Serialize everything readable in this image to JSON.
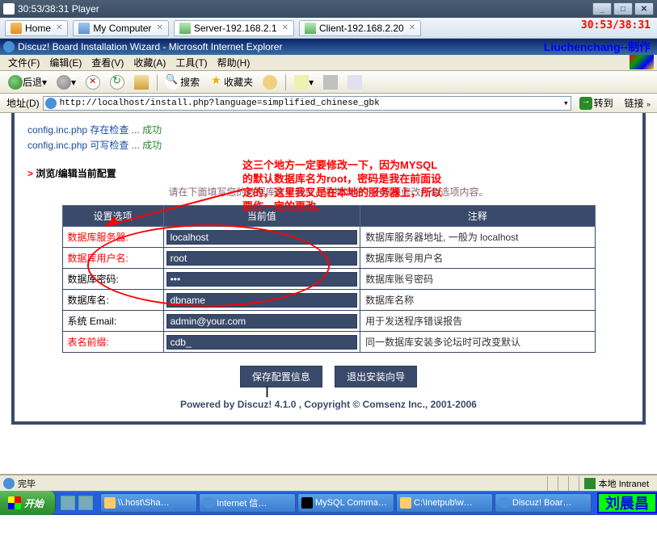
{
  "player": {
    "title": "30:53/38:31 Player",
    "timer": "30:53/38:31",
    "author": "Liuchenchang--制作"
  },
  "outer_tabs": [
    {
      "label": "Home"
    },
    {
      "label": "My Computer"
    },
    {
      "label": "Server-192.168.2.1"
    },
    {
      "label": "Client-192.168.2.20"
    }
  ],
  "ie": {
    "title": "Discuz! Board Installation Wizard - Microsoft Internet Explorer",
    "menus": [
      "文件(F)",
      "编辑(E)",
      "查看(V)",
      "收藏(A)",
      "工具(T)",
      "帮助(H)"
    ],
    "toolbar": {
      "back": "后退",
      "search": "搜索",
      "favorites": "收藏夹"
    },
    "address_label": "地址(D)",
    "url": "http://localhost/install.php?language=simplified_chinese_gbk",
    "go": "转到",
    "links": "链接",
    "status_done": "完毕",
    "status_zone": "本地 Intranet"
  },
  "page": {
    "checks": [
      {
        "text": "config.inc.php 存在检查 ... ",
        "status": "成功"
      },
      {
        "text": "config.inc.php 可写检查 ... ",
        "status": "成功"
      }
    ],
    "section_arrow": ">",
    "section_title": "浏览/编辑当前配置",
    "annotation_l1": "这三个地方一定要修改一下，因为MYSQL",
    "annotation_l2": "的默认数据库名为root，密码是我在前面设",
    "annotation_l3": "定的，这里我又是在本地的服务器上，所以",
    "annotation_l4": "要作一定的更改。",
    "help": "请在下面填写您的数据库账号信息，通常情况下不需要修改红色选项内容。",
    "headers": [
      "设置选项",
      "当前值",
      "注释"
    ],
    "rows": [
      {
        "label": "数据库服务器:",
        "value": "localhost",
        "note": "数据库服务器地址, 一般为 localhost",
        "red": true
      },
      {
        "label": "数据库用户名:",
        "value": "root",
        "note": "数据库账号用户名",
        "red": true
      },
      {
        "label": "数据库密码:",
        "value": "●●●",
        "note": "数据库账号密码",
        "red": false
      },
      {
        "label": "数据库名:",
        "value": "dbname",
        "note": "数据库名称",
        "red": false
      },
      {
        "label": "系统 Email:",
        "value": "admin@your.com",
        "note": "用于发送程序错误报告",
        "red": false
      },
      {
        "label": "表名前缀:",
        "value": "cdb_",
        "note": "同一数据库安装多论坛时可改变默认",
        "red": true
      }
    ],
    "btn_save": "保存配置信息",
    "btn_exit": "退出安装向导",
    "footer": "Powered by Discuz! 4.1.0 ,   Copyright © Comsenz Inc., 2001-2006"
  },
  "taskbar": {
    "start": "开始",
    "tasks": [
      "\\\\.host\\Sha…",
      "Internet 信…",
      "MySQL Comma…",
      "C:\\Inetpub\\w…",
      "Discuz! Boar…"
    ],
    "name_badge": "刘晨昌"
  }
}
